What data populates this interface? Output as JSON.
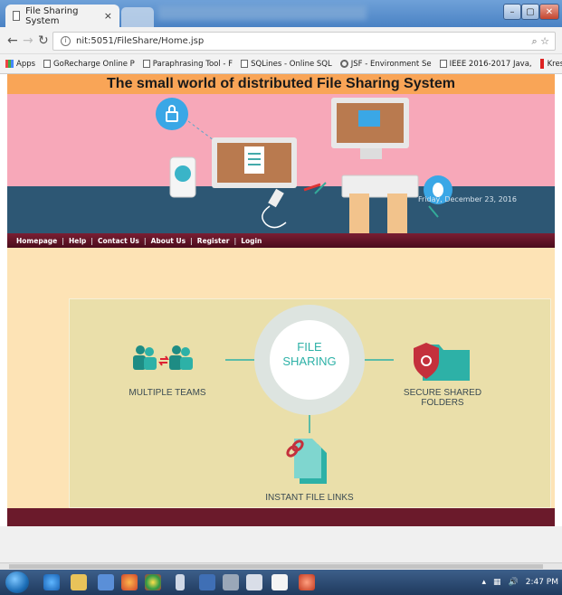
{
  "browser": {
    "tab_title": "File Sharing System",
    "tab_close": "×",
    "url": "nit:5051/FileShare/Home.jsp",
    "url_icons": "⌕ ☆",
    "bookmarks": [
      "Apps",
      "GoRecharge Online P",
      "Paraphrasing Tool - F",
      "SQLines - Online SQL",
      "JSF - Environment Se",
      "IEEE 2016-2017 Java,",
      "Krest Technology | Fr"
    ]
  },
  "site": {
    "header_title": "The small world of distributed File Sharing System",
    "date": "Friday, December 23, 2016",
    "nav": [
      "Homepage",
      "Help",
      "Contact Us",
      "About Us",
      "Register",
      "Login"
    ],
    "nav_sep": "|",
    "center_label_line1": "FILE",
    "center_label_line2": "SHARING",
    "feature_left": "MULTIPLE TEAMS",
    "feature_right_line1": "SECURE SHARED",
    "feature_right_line2": "FOLDERS",
    "feature_bottom": "INSTANT FILE LINKS"
  },
  "taskbar": {
    "time": "2:47 PM"
  },
  "colors": {
    "header_bg": "#f9a557",
    "banner_bg": "#f7a8b9",
    "nav_bg": "#6b1a2b",
    "content_bg": "#fde3b5",
    "accent_teal": "#2db1a7",
    "accent_blue": "#3aa7e6"
  }
}
